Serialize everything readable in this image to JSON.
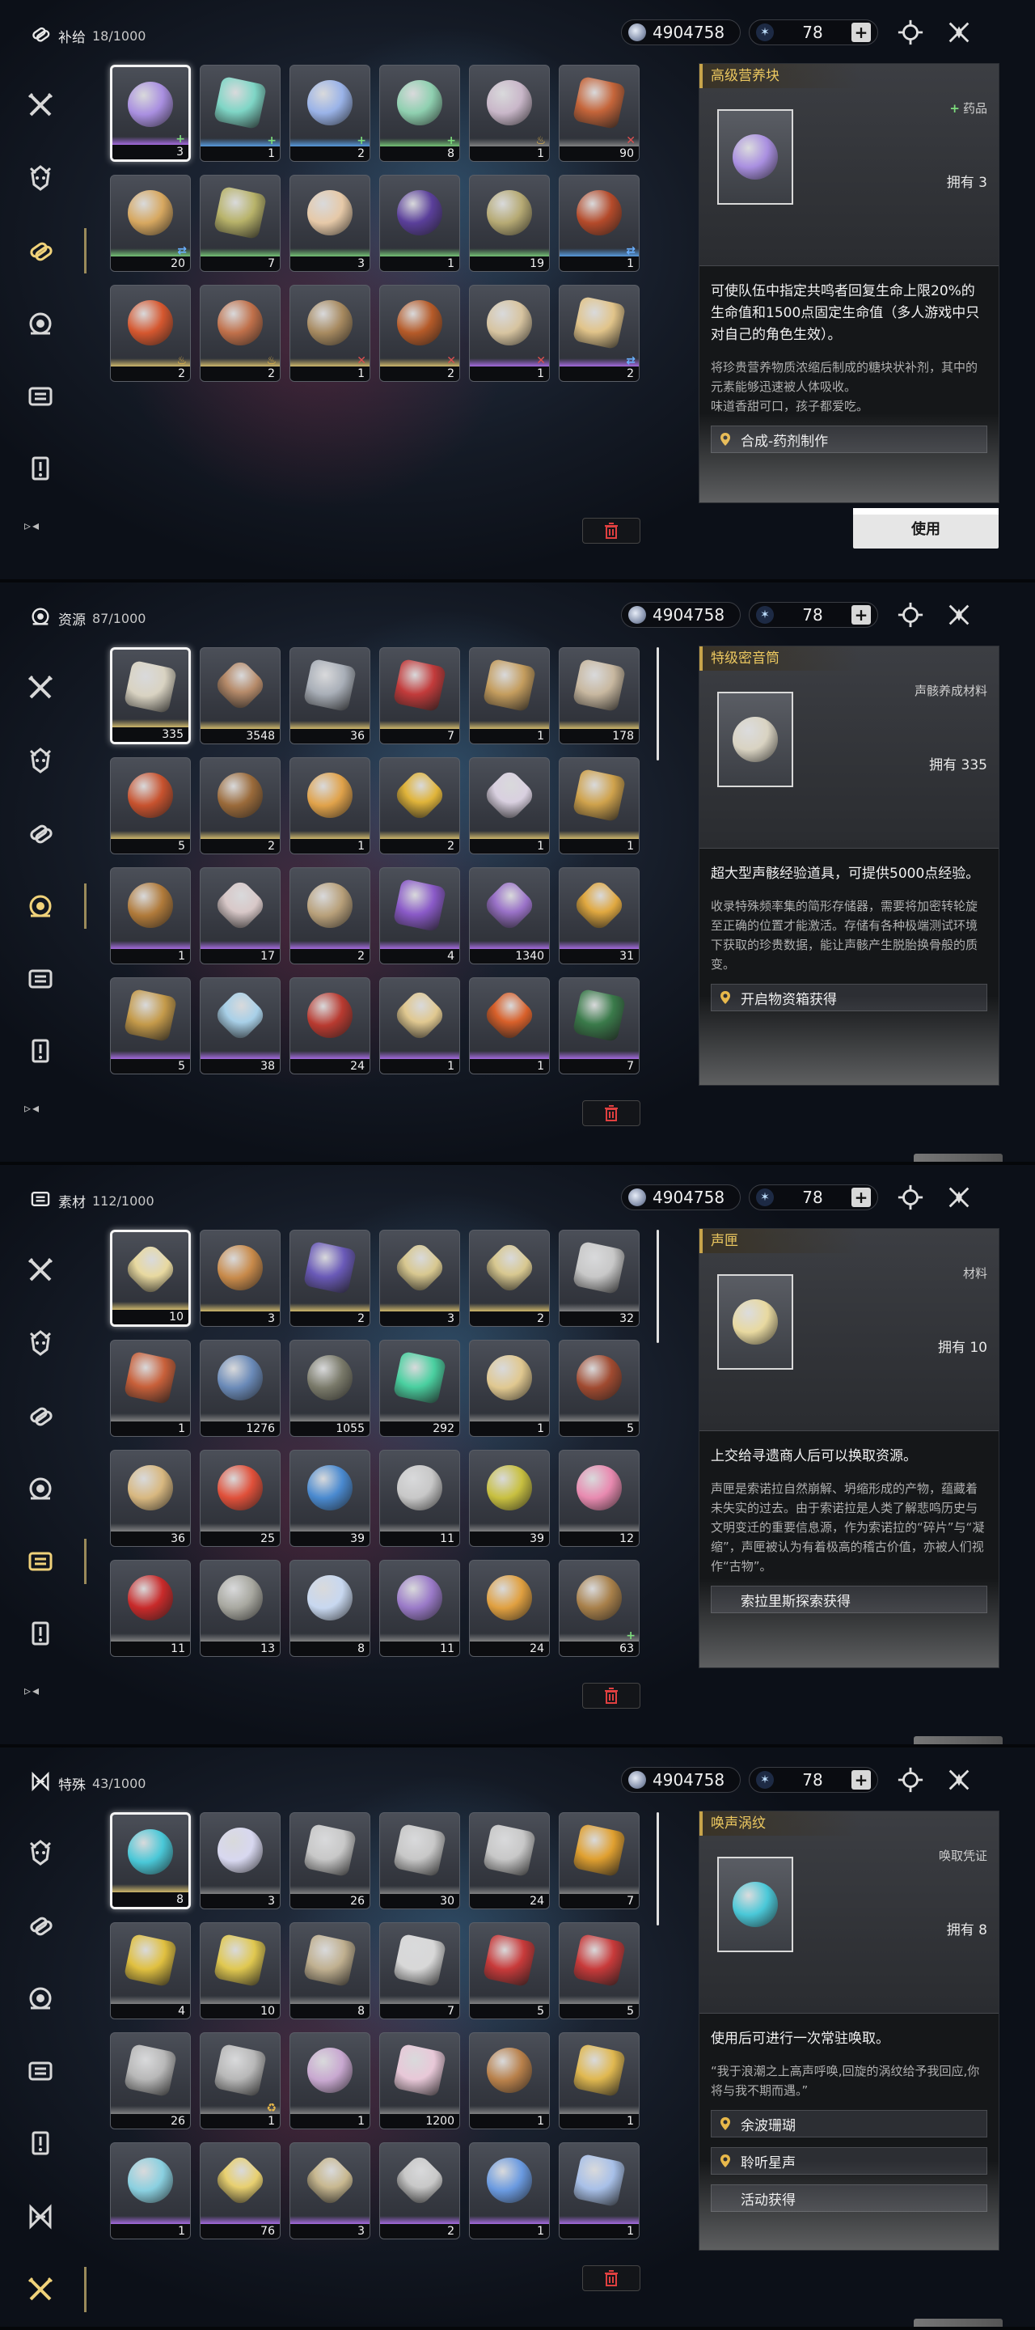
{
  "currency": {
    "coins": "4904758",
    "astrite": "78"
  },
  "panels": [
    {
      "category": "补给",
      "count": "18/1000",
      "active_nav": 2,
      "detail": {
        "name": "高级营养块",
        "type": "药品",
        "type_marker": "+",
        "owned": "拥有 3",
        "effect": "可使队伍中指定共鸣者回复生命上限20%的生命值和1500点固定生命值（多人游戏中只对自己的角色生效）。",
        "desc": "将珍贵营养物质浓缩后制成的糖块状补剂，其中的元素能够迅速被人体吸收。\n味道香甜可口，孩子都爱吃。",
        "sources": [
          {
            "label": "合成-药剂制作",
            "pin": true
          }
        ],
        "use_label": "使用"
      },
      "items": [
        {
          "count": "3",
          "rarity": "purple",
          "color": "#a98fe0",
          "tag": "+",
          "shape": "round"
        },
        {
          "count": "1",
          "rarity": "blue",
          "color": "#7fd6c6",
          "tag": "+",
          "shape": "sq"
        },
        {
          "count": "2",
          "rarity": "blue",
          "color": "#9ab3e8",
          "tag": "+",
          "shape": "round"
        },
        {
          "count": "8",
          "rarity": "green",
          "color": "#8fd0b0",
          "tag": "+",
          "shape": "round"
        },
        {
          "count": "1",
          "rarity": "gray",
          "color": "#c9b7c9",
          "tag": "♨",
          "shape": "round"
        },
        {
          "count": "90",
          "rarity": "gray",
          "color": "#c5653a",
          "tag": "✕",
          "shape": "sq"
        },
        {
          "count": "20",
          "rarity": "green",
          "color": "#d7a860",
          "tag": "⇄",
          "shape": "round"
        },
        {
          "count": "7",
          "rarity": "green",
          "color": "#b8b36a",
          "tag": "",
          "shape": "sq"
        },
        {
          "count": "3",
          "rarity": "green",
          "color": "#e6c9a8",
          "tag": "",
          "shape": "round"
        },
        {
          "count": "1",
          "rarity": "green",
          "color": "#5a3f9a",
          "tag": "",
          "shape": "round"
        },
        {
          "count": "19",
          "rarity": "green",
          "color": "#b6aa74",
          "tag": "",
          "shape": "round"
        },
        {
          "count": "1",
          "rarity": "blue",
          "color": "#b44a2a",
          "tag": "⇄",
          "shape": "round"
        },
        {
          "count": "2",
          "rarity": "gold",
          "color": "#d5572f",
          "tag": "♨",
          "shape": "round"
        },
        {
          "count": "2",
          "rarity": "gold",
          "color": "#c0704a",
          "tag": "♨",
          "shape": "round"
        },
        {
          "count": "1",
          "rarity": "gold",
          "color": "#a78a60",
          "tag": "✕",
          "shape": "round"
        },
        {
          "count": "2",
          "rarity": "gold",
          "color": "#b55a28",
          "tag": "✕",
          "shape": "round"
        },
        {
          "count": "1",
          "rarity": "purple",
          "color": "#d7c4a0",
          "tag": "✕",
          "shape": "round"
        },
        {
          "count": "2",
          "rarity": "purple",
          "color": "#e1c48a",
          "tag": "⇄",
          "shape": "sq"
        }
      ]
    },
    {
      "category": "资源",
      "count": "87/1000",
      "active_nav": 3,
      "detail": {
        "name": "特级密音筒",
        "type": "声骸养成材料",
        "type_marker": "",
        "owned": "拥有 335",
        "effect": "超大型声骸经验道具，可提供5000点经验。",
        "desc": "收录特殊频率集的简形存储器，需要将加密转轮旋至正确的位置才能激活。存储有各种极端测试环境下获取的珍贵数据，能让声骸产生脱胎换骨般的质变。",
        "sources": [
          {
            "label": "开启物资箱获得",
            "pin": true
          }
        ],
        "use_label": ""
      },
      "items": [
        {
          "count": "335",
          "rarity": "gold",
          "color": "#d9d3c2",
          "tag": "",
          "shape": "sq"
        },
        {
          "count": "3548",
          "rarity": "gold",
          "color": "#b68b6a",
          "tag": "",
          "shape": "hx"
        },
        {
          "count": "36",
          "rarity": "gold",
          "color": "#a9afb8",
          "tag": "",
          "shape": "sq"
        },
        {
          "count": "7",
          "rarity": "gold",
          "color": "#c23b3b",
          "tag": "",
          "shape": "sq"
        },
        {
          "count": "1",
          "rarity": "gold",
          "color": "#c49d5e",
          "tag": "",
          "shape": "sq"
        },
        {
          "count": "178",
          "rarity": "gold",
          "color": "#c8b8a0",
          "tag": "",
          "shape": "sq"
        },
        {
          "count": "5",
          "rarity": "gold",
          "color": "#c7522e",
          "tag": "",
          "shape": "round"
        },
        {
          "count": "2",
          "rarity": "gold",
          "color": "#9a6a3a",
          "tag": "",
          "shape": "round"
        },
        {
          "count": "1",
          "rarity": "gold",
          "color": "#e0a24a",
          "tag": "",
          "shape": "round"
        },
        {
          "count": "2",
          "rarity": "gold",
          "color": "#e0b43a",
          "tag": "",
          "shape": "hx"
        },
        {
          "count": "1",
          "rarity": "gold",
          "color": "#d9d0e0",
          "tag": "",
          "shape": "hx"
        },
        {
          "count": "1",
          "rarity": "gold",
          "color": "#cfa24c",
          "tag": "",
          "shape": "sq"
        },
        {
          "count": "1",
          "rarity": "purple",
          "color": "#b07a3a",
          "tag": "",
          "shape": "round"
        },
        {
          "count": "17",
          "rarity": "purple",
          "color": "#d8c8c8",
          "tag": "",
          "shape": "hx"
        },
        {
          "count": "2",
          "rarity": "purple",
          "color": "#b8a07a",
          "tag": "",
          "shape": "round"
        },
        {
          "count": "4",
          "rarity": "purple",
          "color": "#8a5ac8",
          "tag": "",
          "shape": "sq"
        },
        {
          "count": "1340",
          "rarity": "purple",
          "color": "#9a72c8",
          "tag": "",
          "shape": "hx"
        },
        {
          "count": "31",
          "rarity": "purple",
          "color": "#e0a840",
          "tag": "",
          "shape": "hx"
        },
        {
          "count": "5",
          "rarity": "purple",
          "color": "#c49a4a",
          "tag": "",
          "shape": "sq"
        },
        {
          "count": "38",
          "rarity": "purple",
          "color": "#a8d0e8",
          "tag": "",
          "shape": "hx"
        },
        {
          "count": "24",
          "rarity": "purple",
          "color": "#b83a30",
          "tag": "",
          "shape": "round"
        },
        {
          "count": "1",
          "rarity": "purple",
          "color": "#e0c890",
          "tag": "",
          "shape": "hx"
        },
        {
          "count": "1",
          "rarity": "purple",
          "color": "#d8602a",
          "tag": "",
          "shape": "hx"
        },
        {
          "count": "7",
          "rarity": "purple",
          "color": "#3a7a4a",
          "tag": "",
          "shape": "sq"
        }
      ]
    },
    {
      "category": "素材",
      "count": "112/1000",
      "active_nav": 4,
      "detail": {
        "name": "声匣",
        "type": "材料",
        "type_marker": "",
        "owned": "拥有 10",
        "effect": "上交给寻遗商人后可以换取资源。",
        "desc": "声匣是索诺拉自然崩解、坍缩形成的产物，蕴藏着未失实的过去。由于索诺拉是人类了解悲鸣历史与文明变迁的重要信息源，作为索诺拉的“碎片”与“凝缩”，声匣被认为有着极高的稽古价值，亦被人们视作“古物”。",
        "sources": [
          {
            "label": "索拉里斯探索获得",
            "pin": false
          }
        ],
        "use_label": ""
      },
      "items": [
        {
          "count": "10",
          "rarity": "gold",
          "color": "#e8d9a0",
          "tag": "",
          "shape": "hx"
        },
        {
          "count": "3",
          "rarity": "gold",
          "color": "#c88a4a",
          "tag": "",
          "shape": "round"
        },
        {
          "count": "2",
          "rarity": "gold",
          "color": "#6a5ab8",
          "tag": "",
          "shape": "sq"
        },
        {
          "count": "3",
          "rarity": "gold",
          "color": "#d8c890",
          "tag": "",
          "shape": "hx"
        },
        {
          "count": "2",
          "rarity": "gold",
          "color": "#d8c890",
          "tag": "",
          "shape": "hx"
        },
        {
          "count": "32",
          "rarity": "gray",
          "color": "#c8c8c8",
          "tag": "",
          "shape": "sq"
        },
        {
          "count": "1",
          "rarity": "gray",
          "color": "#c8603a",
          "tag": "",
          "shape": "sq"
        },
        {
          "count": "1276",
          "rarity": "gray",
          "color": "#6a8ab8",
          "tag": "",
          "shape": "round"
        },
        {
          "count": "1055",
          "rarity": "gray",
          "color": "#7a7a6a",
          "tag": "",
          "shape": "round"
        },
        {
          "count": "292",
          "rarity": "gray",
          "color": "#4ad0a0",
          "tag": "",
          "shape": "sq"
        },
        {
          "count": "1",
          "rarity": "gray",
          "color": "#e0c890",
          "tag": "",
          "shape": "round"
        },
        {
          "count": "5",
          "rarity": "gray",
          "color": "#a04a30",
          "tag": "",
          "shape": "round"
        },
        {
          "count": "36",
          "rarity": "gray",
          "color": "#d8b880",
          "tag": "",
          "shape": "round"
        },
        {
          "count": "25",
          "rarity": "gray",
          "color": "#e0503a",
          "tag": "",
          "shape": "round"
        },
        {
          "count": "39",
          "rarity": "gray",
          "color": "#4a8ad0",
          "tag": "",
          "shape": "round"
        },
        {
          "count": "11",
          "rarity": "gray",
          "color": "#c8c8c8",
          "tag": "",
          "shape": "round"
        },
        {
          "count": "39",
          "rarity": "gray",
          "color": "#c8c040",
          "tag": "",
          "shape": "round"
        },
        {
          "count": "12",
          "rarity": "gray",
          "color": "#e88ab0",
          "tag": "",
          "shape": "round"
        },
        {
          "count": "11",
          "rarity": "gray",
          "color": "#c82a2a",
          "tag": "",
          "shape": "round"
        },
        {
          "count": "13",
          "rarity": "gray",
          "color": "#a8a8a0",
          "tag": "",
          "shape": "round"
        },
        {
          "count": "8",
          "rarity": "gray",
          "color": "#c8d8f0",
          "tag": "",
          "shape": "round"
        },
        {
          "count": "11",
          "rarity": "gray",
          "color": "#9a7ac8",
          "tag": "",
          "shape": "round"
        },
        {
          "count": "24",
          "rarity": "gray",
          "color": "#e0a040",
          "tag": "",
          "shape": "round"
        },
        {
          "count": "63",
          "rarity": "gray",
          "color": "#a8804a",
          "tag": "+",
          "shape": "round"
        }
      ]
    },
    {
      "category": "特殊",
      "count": "43/1000",
      "active_nav": 6,
      "detail": {
        "name": "唤声涡纹",
        "type": "唤取凭证",
        "type_marker": "",
        "owned": "拥有 8",
        "effect": "使用后可进行一次常驻唤取。",
        "desc": "“我于浪潮之上高声呼唤,回旋的涡纹给予我回应,你将与我不期而遇。”",
        "sources": [
          {
            "label": "余波珊瑚",
            "pin": true
          },
          {
            "label": "聆听星声",
            "pin": true
          },
          {
            "label": "活动获得",
            "pin": false
          }
        ],
        "use_label": ""
      },
      "items": [
        {
          "count": "8",
          "rarity": "gold",
          "color": "#4ac8d8",
          "tag": "",
          "shape": "round"
        },
        {
          "count": "3",
          "rarity": "gray",
          "color": "#d8d8f0",
          "tag": "",
          "shape": "round"
        },
        {
          "count": "26",
          "rarity": "gray",
          "color": "#c8c8c8",
          "tag": "",
          "shape": "sq"
        },
        {
          "count": "30",
          "rarity": "gray",
          "color": "#c8c8c8",
          "tag": "",
          "shape": "sq"
        },
        {
          "count": "24",
          "rarity": "gray",
          "color": "#c8c8c8",
          "tag": "",
          "shape": "sq"
        },
        {
          "count": "7",
          "rarity": "gray",
          "color": "#e0a030",
          "tag": "",
          "shape": "sq"
        },
        {
          "count": "4",
          "rarity": "gray",
          "color": "#e0c040",
          "tag": "",
          "shape": "sq"
        },
        {
          "count": "10",
          "rarity": "gray",
          "color": "#e0c850",
          "tag": "",
          "shape": "sq"
        },
        {
          "count": "8",
          "rarity": "gray",
          "color": "#c0b090",
          "tag": "",
          "shape": "sq"
        },
        {
          "count": "7",
          "rarity": "gray",
          "color": "#d8d8d8",
          "tag": "",
          "shape": "sq"
        },
        {
          "count": "5",
          "rarity": "gray",
          "color": "#c83a3a",
          "tag": "",
          "shape": "sq"
        },
        {
          "count": "5",
          "rarity": "gray",
          "color": "#c83a3a",
          "tag": "",
          "shape": "sq"
        },
        {
          "count": "26",
          "rarity": "gray",
          "color": "#b8b8b8",
          "tag": "",
          "shape": "sq"
        },
        {
          "count": "1",
          "rarity": "gray",
          "color": "#b8b8b8",
          "tag": "♻",
          "shape": "sq"
        },
        {
          "count": "1",
          "rarity": "gray",
          "color": "#c8a8d0",
          "tag": "",
          "shape": "round"
        },
        {
          "count": "1200",
          "rarity": "gray",
          "color": "#e8c8d8",
          "tag": "",
          "shape": "sq"
        },
        {
          "count": "1",
          "rarity": "gray",
          "color": "#b8804a",
          "tag": "",
          "shape": "round"
        },
        {
          "count": "1",
          "rarity": "gray",
          "color": "#e0b850",
          "tag": "",
          "shape": "sq"
        },
        {
          "count": "1",
          "rarity": "purple",
          "color": "#8ad0e0",
          "tag": "",
          "shape": "round"
        },
        {
          "count": "76",
          "rarity": "purple",
          "color": "#e8d070",
          "tag": "",
          "shape": "hx"
        },
        {
          "count": "3",
          "rarity": "purple",
          "color": "#c8b890",
          "tag": "",
          "shape": "hx"
        },
        {
          "count": "2",
          "rarity": "purple",
          "color": "#c8c8c8",
          "tag": "",
          "shape": "hx"
        },
        {
          "count": "1",
          "rarity": "purple",
          "color": "#6a9ae0",
          "tag": "",
          "shape": "round"
        },
        {
          "count": "1",
          "rarity": "purple",
          "color": "#a8c0e8",
          "tag": "",
          "shape": "sq"
        }
      ]
    }
  ]
}
